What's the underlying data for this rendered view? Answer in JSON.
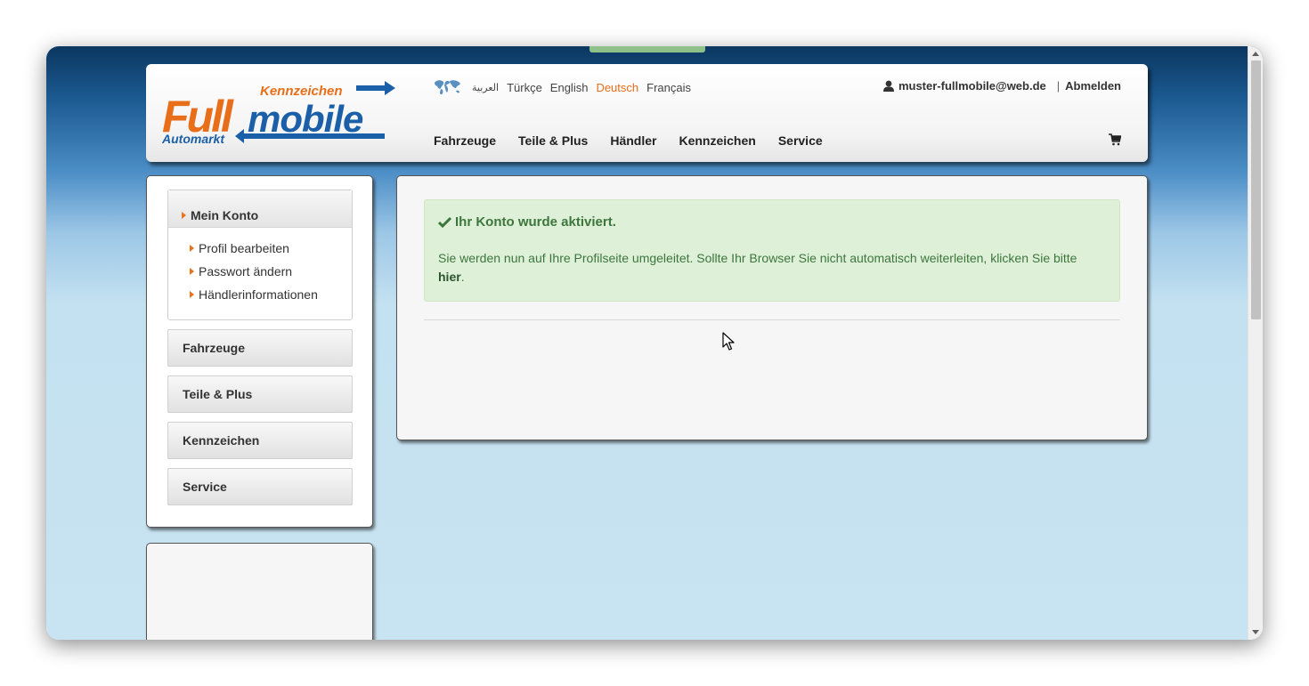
{
  "header": {
    "logo_texts": {
      "top": "Kennzeichen",
      "main_left": "Full",
      "main_right": "mobile",
      "bottom": "Automarkt"
    },
    "languages": [
      {
        "label": "العربية",
        "active": false
      },
      {
        "label": "Türkçe",
        "active": false
      },
      {
        "label": "English",
        "active": false
      },
      {
        "label": "Deutsch",
        "active": true
      },
      {
        "label": "Français",
        "active": false
      }
    ],
    "user_email": "muster-fullmobile@web.de",
    "separator": "|",
    "logout": "Abmelden",
    "nav": [
      "Fahrzeuge",
      "Teile & Plus",
      "Händler",
      "Kennzeichen",
      "Service"
    ],
    "cart_icon": "cart-icon"
  },
  "sidebar": {
    "account_title": "Mein Konto",
    "account_items": [
      "Profil bearbeiten",
      "Passwort ändern",
      "Händlerinformationen"
    ],
    "sections": [
      "Fahrzeuge",
      "Teile & Plus",
      "Kennzeichen",
      "Service"
    ]
  },
  "main": {
    "alert_title": "Ihr Konto wurde aktiviert.",
    "alert_text": "Sie werden nun auf Ihre Profilseite umgeleitet. Sollte Ihr Browser Sie nicht automatisch weiterleiten, klicken Sie bitte",
    "alert_link": "hier",
    "alert_end": "."
  },
  "colors": {
    "accent_orange": "#e86e1a",
    "brand_blue": "#1a5fa8",
    "alert_bg": "#dff0d8",
    "alert_text": "#3c763d"
  }
}
